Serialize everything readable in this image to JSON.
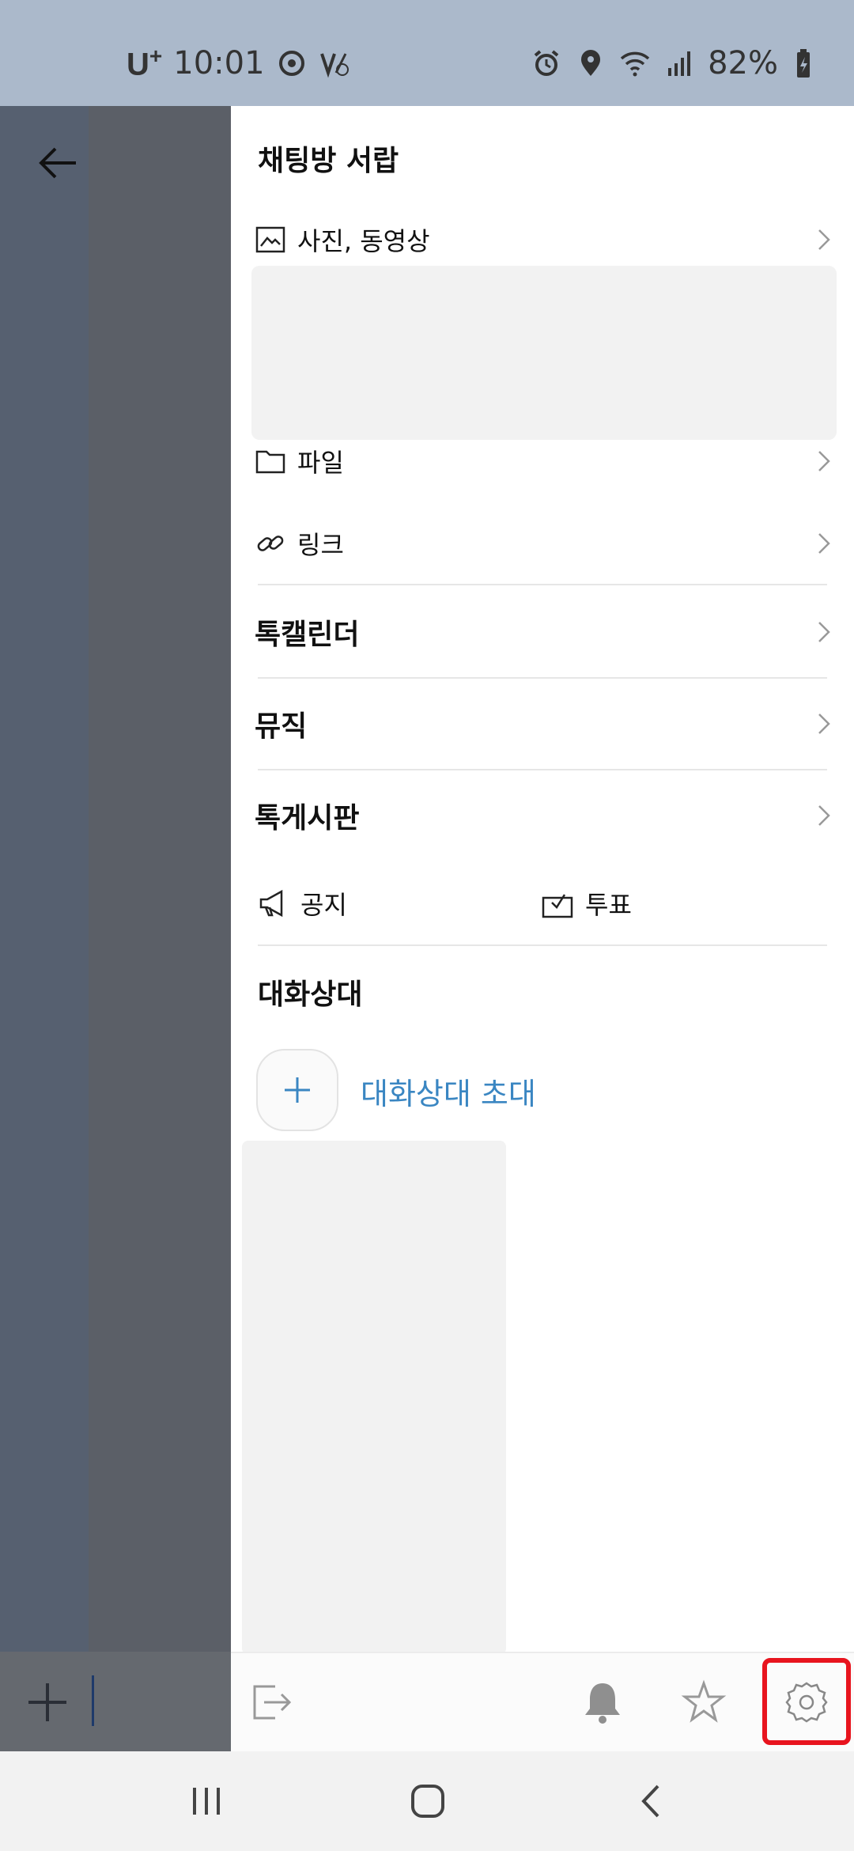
{
  "status_bar": {
    "carrier": "U",
    "carrier_sup": "+",
    "time": "10:01",
    "battery": "82%",
    "icons": [
      "sync-icon",
      "volte-icon",
      "alarm-icon",
      "location-icon",
      "wifi-icon",
      "signal-icon",
      "battery-icon"
    ]
  },
  "drawer": {
    "title": "채팅방 서랍",
    "media": {
      "label": "사진, 동영상",
      "icon": "image-icon"
    },
    "file": {
      "label": "파일",
      "icon": "folder-icon"
    },
    "link": {
      "label": "링크",
      "icon": "link-icon"
    },
    "calendar": {
      "label": "톡캘린더"
    },
    "music": {
      "label": "뮤직"
    },
    "board": {
      "label": "톡게시판"
    },
    "notice": {
      "label": "공지",
      "icon": "megaphone-icon"
    },
    "vote": {
      "label": "투표",
      "icon": "ballot-box-icon"
    },
    "members": {
      "title": "대화상대",
      "invite_label": "대화상대 초대"
    },
    "footer": {
      "icons": [
        "leave-chat-icon",
        "bell-icon",
        "star-icon",
        "gear-icon"
      ],
      "highlight_color": "#e8141e"
    }
  },
  "colors": {
    "accent_link": "#3a86c2",
    "status_bar_bg": "#abb9cb",
    "overlay_bg": "#566070"
  },
  "nav_bar": {
    "icons": [
      "recent-apps-icon",
      "home-icon",
      "back-icon"
    ]
  }
}
